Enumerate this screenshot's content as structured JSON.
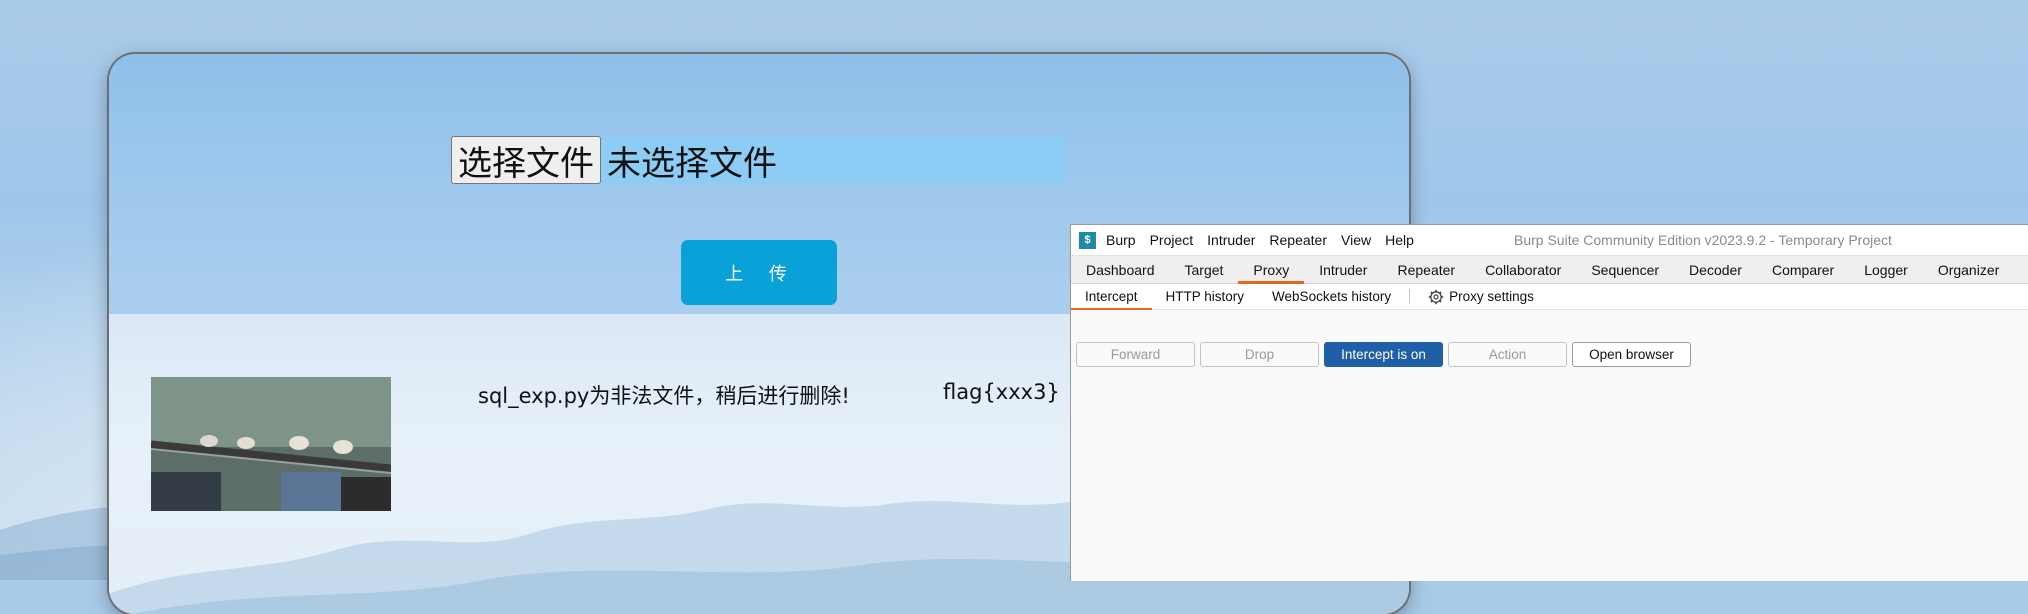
{
  "web_page": {
    "choose_file_label": "选择文件",
    "no_file_text": "未选择文件",
    "upload_label": "上 传",
    "file_message": "sql_exp.py为非法文件，稍后进行删除!",
    "flag_text": "flag{xxx3}"
  },
  "burp": {
    "logo_char": "$",
    "menu": [
      "Burp",
      "Project",
      "Intruder",
      "Repeater",
      "View",
      "Help"
    ],
    "title": "Burp Suite Community Edition v2023.9.2 - Temporary Project",
    "tabs": [
      "Dashboard",
      "Target",
      "Proxy",
      "Intruder",
      "Repeater",
      "Collaborator",
      "Sequencer",
      "Decoder",
      "Comparer",
      "Logger",
      "Organizer"
    ],
    "active_tab": "Proxy",
    "subtabs": [
      "Intercept",
      "HTTP history",
      "WebSockets history"
    ],
    "proxy_settings_label": "Proxy settings",
    "buttons": {
      "forward": "Forward",
      "drop": "Drop",
      "intercept": "Intercept is on",
      "action": "Action",
      "open_browser": "Open browser"
    },
    "accent_color": "#e8691d",
    "intercept_color": "#1e5fa6"
  }
}
